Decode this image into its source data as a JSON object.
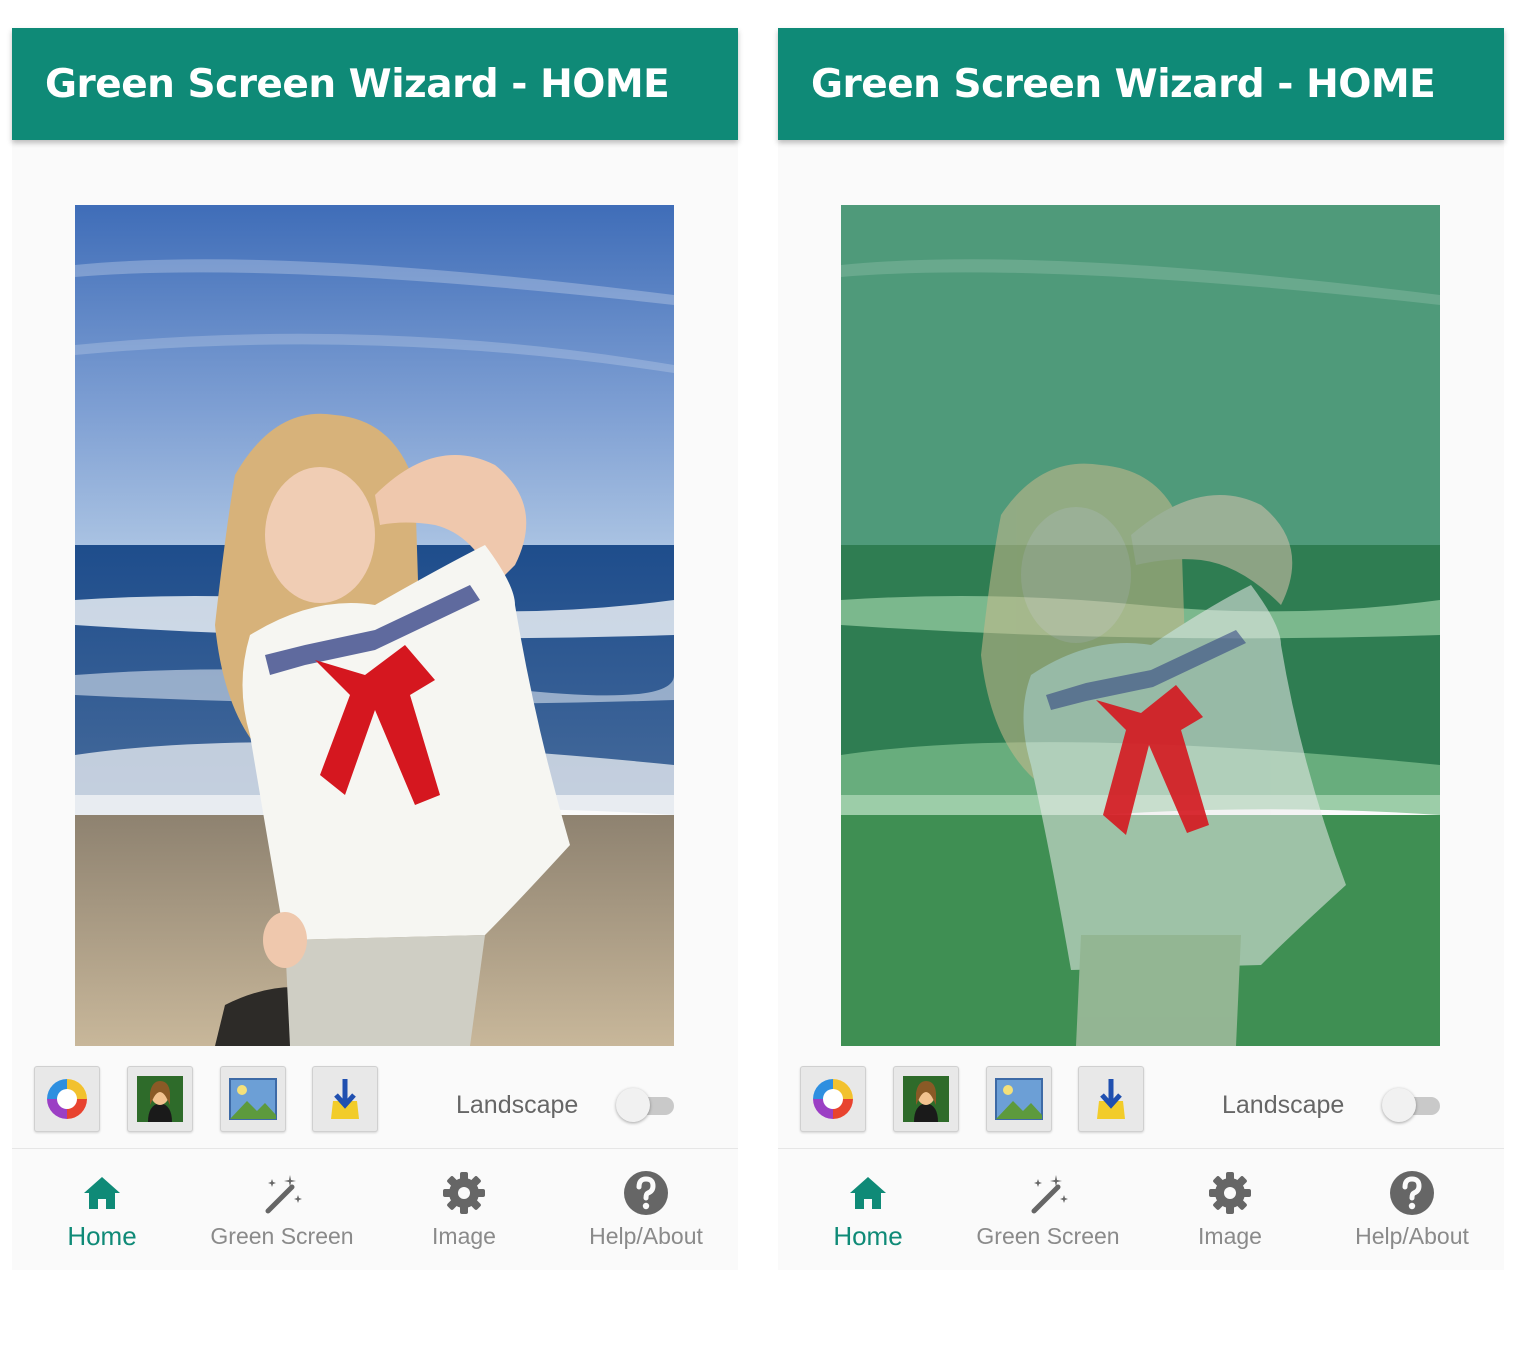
{
  "screens": [
    {
      "app_title": "Green Screen Wizard - HOME",
      "mode": "composite",
      "landscape_label": "Landscape",
      "landscape_on": false,
      "tools": [
        "color-wheel-icon",
        "portrait-icon",
        "landscape-picture-icon",
        "save-download-icon"
      ],
      "nav": [
        {
          "label": "Home",
          "icon": "home-icon",
          "active": true
        },
        {
          "label": "Green Screen",
          "icon": "magic-wand-icon",
          "active": false
        },
        {
          "label": "Image",
          "icon": "gear-icon",
          "active": false
        },
        {
          "label": "Help/About",
          "icon": "help-icon",
          "active": false
        }
      ]
    },
    {
      "app_title": "Green Screen Wizard - HOME",
      "mode": "green-overlay",
      "landscape_label": "Landscape",
      "landscape_on": false,
      "tools": [
        "color-wheel-icon",
        "portrait-icon",
        "landscape-picture-icon",
        "save-download-icon"
      ],
      "nav": [
        {
          "label": "Home",
          "icon": "home-icon",
          "active": true
        },
        {
          "label": "Green Screen",
          "icon": "magic-wand-icon",
          "active": false
        },
        {
          "label": "Image",
          "icon": "gear-icon",
          "active": false
        },
        {
          "label": "Help/About",
          "icon": "help-icon",
          "active": false
        }
      ]
    }
  ],
  "colors": {
    "app_bar": "#0f8a77",
    "nav_active": "#0f8a77",
    "nav_inactive": "#8a8a8a",
    "green_overlay": "#1c965a"
  }
}
